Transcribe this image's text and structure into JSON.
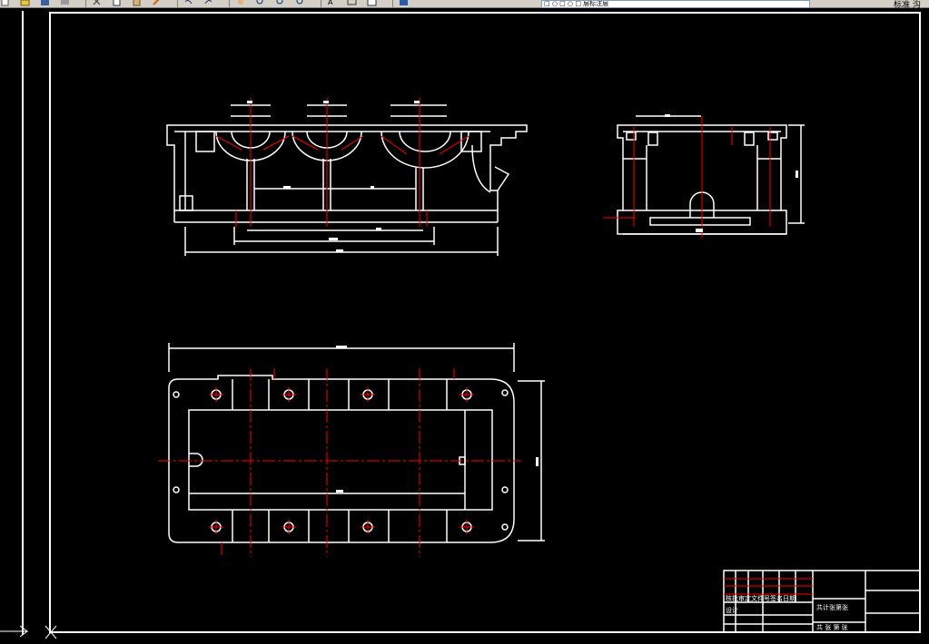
{
  "toolbar": {
    "layer_value": "□ ○ □ ○ □ 层标注层",
    "right_label": "标准 沟",
    "buttons": [
      "new-icon",
      "open-icon",
      "save-icon",
      "print-icon",
      "preview-icon",
      "cut-icon",
      "copy-icon",
      "paste-icon",
      "match-icon",
      "undo-icon",
      "redo-icon",
      "pan-icon",
      "zoom-realtime-icon",
      "zoom-window-icon",
      "zoom-previous-icon",
      "text-style-icon",
      "dimension-icon",
      "table-icon",
      "layer-icon",
      "properties-icon"
    ]
  },
  "title_block": {
    "row1": "核批审定文件号签名日期",
    "row2": "设计",
    "company": "共计张第张",
    "part": "比例 材料",
    "sheet": "共 张 第 张"
  },
  "dims": {
    "front_total": "▬▬",
    "top_total": "▬▬",
    "side_total": "▬"
  },
  "colors": {
    "background": "#000000",
    "line": "#ffffff",
    "center": "#ff0000",
    "toolbar": "#d4d0c8"
  }
}
